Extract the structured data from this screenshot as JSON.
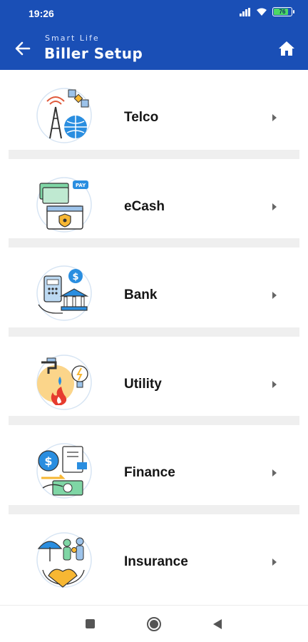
{
  "status": {
    "time": "19:26",
    "battery": "76",
    "battery_level": 0.76
  },
  "header": {
    "subtitle": "Smart Life",
    "title": "Biller Setup",
    "back_icon": "arrow-left-icon",
    "home_icon": "home-icon"
  },
  "items": [
    {
      "label": "Telco",
      "icon": "telco-icon"
    },
    {
      "label": "eCash",
      "icon": "ecash-icon"
    },
    {
      "label": "Bank",
      "icon": "bank-icon"
    },
    {
      "label": "Utility",
      "icon": "utility-icon"
    },
    {
      "label": "Finance",
      "icon": "finance-icon"
    },
    {
      "label": "Insurance",
      "icon": "insurance-icon"
    }
  ],
  "colors": {
    "header_bg": "#1a4fb6",
    "accent_blue": "#2a8ee0",
    "accent_yellow": "#f7b733",
    "accent_red": "#e63c2f",
    "divider": "#efefef"
  }
}
